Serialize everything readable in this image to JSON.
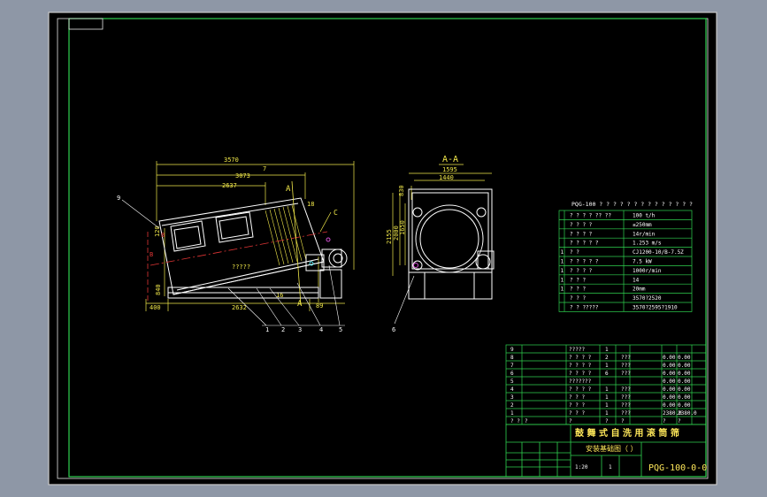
{
  "colors": {
    "viewport_bg": "#8e97a6",
    "canvas": "#000000",
    "line": "#ffffff",
    "dim": "#f1e84a",
    "table": "#2fd24f",
    "title_text": "#ffe85a",
    "center": "#e03535",
    "cyan": "#4fe0e6",
    "magenta": "#d24fd2"
  },
  "drawing": {
    "number": "PQG-100-0-0",
    "title_line1": "鼓 舞 式 自 洗 用 滚 筒 筛",
    "title_line2": "安装基础图（  ）",
    "scale": "1:20",
    "sheet": "1"
  },
  "side_view": {
    "dims": {
      "overall": "3570",
      "top_a": "3073",
      "top_b": "2637",
      "base": "2632",
      "offset": "400",
      "height": "840",
      "right_h": "89",
      "angle": "7",
      "small_a": "18",
      "small_b": "16",
      "small_c": "120"
    },
    "section_labels": {
      "a1": "A",
      "a2": "A",
      "c": "C"
    },
    "center_note": "?????",
    "callouts": [
      "9",
      "1",
      "2",
      "3",
      "4",
      "5"
    ],
    "center_marks": [
      "B",
      "8"
    ]
  },
  "section_view": {
    "title": "A-A",
    "dims": {
      "w_outer": "1595",
      "w_inner": "1440",
      "h_a": "2155",
      "h_b": "2000",
      "h_c": "1650",
      "h_d": "830"
    },
    "callout": "6"
  },
  "parameters": {
    "title": "PQG-100 ? ? ? ? ? ? ? ? ? ? ? ? ? ?",
    "rows": [
      {
        "idx": "",
        "name": "? ? ? ? ?? ??",
        "value": "100 t/h"
      },
      {
        "idx": "",
        "name": "? ? ? ?",
        "value": "≤250mm"
      },
      {
        "idx": "",
        "name": "? ? ? ?",
        "value": "14r/min"
      },
      {
        "idx": "",
        "name": "? ? ? ? ?",
        "value": "1.253 m/s"
      },
      {
        "idx": "1",
        "name": "? ?",
        "value": "CJ1200-10/B-7.5Z"
      },
      {
        "idx": "1",
        "name": "? ? ? ? ?",
        "value": "7.5 kW"
      },
      {
        "idx": "1",
        "name": "? ? ? ?",
        "value": "1000r/min"
      },
      {
        "idx": "1",
        "name": "? ? ?",
        "value": "14"
      },
      {
        "idx": "1",
        "name": "? ? ?",
        "value": "20mm"
      },
      {
        "idx": "",
        "name": "? ? ?",
        "value": "3570?2520"
      },
      {
        "idx": "",
        "name": "? ? ?????",
        "value": "3570?2595?1910"
      }
    ]
  },
  "bom": {
    "rows": [
      {
        "no": "9",
        "code": "",
        "name": "?????",
        "qty": "1",
        "mat": "",
        "w1": "",
        "w2": ""
      },
      {
        "no": "8",
        "code": "",
        "name": "? ? ? ?",
        "qty": "2",
        "mat": "???",
        "w1": "0.00",
        "w2": "0.00"
      },
      {
        "no": "7",
        "code": "",
        "name": "? ? ? ?",
        "qty": "1",
        "mat": "???",
        "w1": "0.00",
        "w2": "0.00"
      },
      {
        "no": "6",
        "code": "",
        "name": "? ? ? ?",
        "qty": "6",
        "mat": "???",
        "w1": "0.00",
        "w2": "0.00"
      },
      {
        "no": "5",
        "code": "",
        "name": "???????",
        "qty": "",
        "mat": "",
        "w1": "0.00",
        "w2": "0.00"
      },
      {
        "no": "4",
        "code": "",
        "name": "? ? ? ?",
        "qty": "1",
        "mat": "???",
        "w1": "0.00",
        "w2": "0.00"
      },
      {
        "no": "3",
        "code": "",
        "name": "? ? ?",
        "qty": "1",
        "mat": "???",
        "w1": "0.00",
        "w2": "0.00"
      },
      {
        "no": "2",
        "code": "",
        "name": "? ? ?",
        "qty": "1",
        "mat": "???",
        "w1": "0.00",
        "w2": "0.00"
      },
      {
        "no": "1",
        "code": "",
        "name": "? ? ?",
        "qty": "1",
        "mat": "???",
        "w1": "2380.0",
        "w2": "2380.0"
      }
    ],
    "header": {
      "no": "? ?",
      "code": "?",
      "name": "?",
      "qty": "?",
      "mat": "?",
      "w1": "?",
      "w2": "?"
    }
  }
}
